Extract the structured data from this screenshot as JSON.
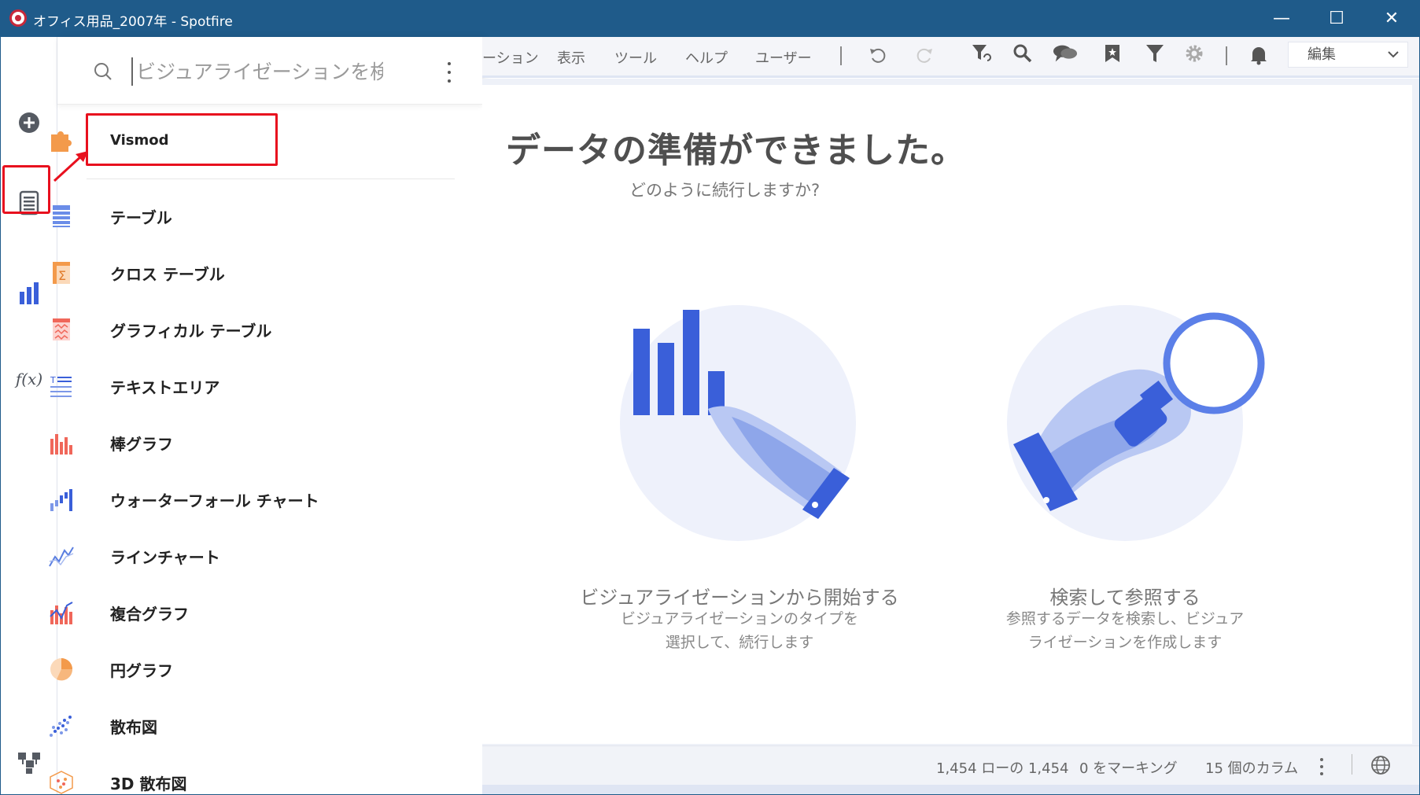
{
  "window": {
    "title": "オフィス用品_2007年 - Spotfire",
    "minimize": "—",
    "maximize": "☐",
    "close": "✕"
  },
  "rail": {
    "icons": [
      "add-icon",
      "visualization-list-icon",
      "bar-chart-icon",
      "function-icon",
      "hierarchy-icon"
    ],
    "fx_label": "f(x)"
  },
  "panel": {
    "search_placeholder": "ビジュアライゼーションを検索",
    "items": [
      {
        "label": "Vismod",
        "icon": "puzzle-icon"
      },
      {
        "label": "テーブル",
        "icon": "table-icon"
      },
      {
        "label": "クロス テーブル",
        "icon": "cross-table-icon"
      },
      {
        "label": "グラフィカル テーブル",
        "icon": "graphical-table-icon"
      },
      {
        "label": "テキストエリア",
        "icon": "text-area-icon"
      },
      {
        "label": "棒グラフ",
        "icon": "bar-chart-icon"
      },
      {
        "label": "ウォーターフォール チャート",
        "icon": "waterfall-chart-icon"
      },
      {
        "label": "ラインチャート",
        "icon": "line-chart-icon"
      },
      {
        "label": "複合グラフ",
        "icon": "combination-chart-icon"
      },
      {
        "label": "円グラフ",
        "icon": "pie-chart-icon"
      },
      {
        "label": "散布図",
        "icon": "scatter-plot-icon"
      },
      {
        "label": "3D 散布図",
        "icon": "3d-scatter-plot-icon"
      }
    ]
  },
  "toolbar": {
    "menus": [
      "ーション",
      "表示",
      "ツール",
      "ヘルプ",
      "ユーザー"
    ],
    "edit_label": "編集",
    "icons": [
      "undo-icon",
      "redo-icon",
      "filter-reset-icon",
      "search-icon",
      "comments-icon",
      "bookmark-icon",
      "filter-icon",
      "settings-icon",
      "notification-icon"
    ]
  },
  "main": {
    "heading": "データの準備ができました。",
    "subheading": "どのように続行しますか?",
    "option_visual": {
      "title": "ビジュアライゼーションから開始する",
      "desc_line1": "ビジュアライゼーションのタイプを",
      "desc_line2": "選択して、続行します"
    },
    "option_search": {
      "title": "検索して参照する",
      "desc_line1": "参照するデータを検索し、ビジュア",
      "desc_line2": "ライゼーションを作成します"
    }
  },
  "status": {
    "rows": "1,454 ローの 1,454",
    "marking": "0 をマーキング",
    "columns": "15 個のカラム"
  },
  "colors": {
    "titlebar": "#1f5b8a",
    "accent_blue": "#3a5fd9",
    "highlight_red": "#e8101e",
    "vismod_orange": "#f39a4b"
  }
}
